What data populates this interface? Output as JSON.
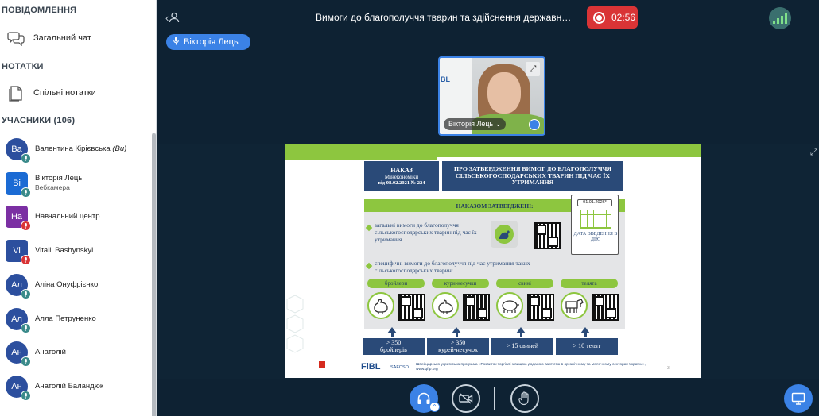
{
  "sidebar": {
    "messages_title": "ПОВІДОМЛЕННЯ",
    "public_chat": "Загальний чат",
    "notes_title": "НОТАТКИ",
    "shared_notes": "Спільні нотатки",
    "users_title": "УЧАСНИКИ (106)",
    "users": [
      {
        "initials": "Ва",
        "name": "Валентина Кірієвська",
        "suffix": "(Ви)",
        "sub": "",
        "color": "#2c4f9e",
        "square": false,
        "mic": "on"
      },
      {
        "initials": "Ві",
        "name": "Вікторія Лець",
        "suffix": "",
        "sub": "Вебкамера",
        "color": "#1b6bd4",
        "square": true,
        "mic": "on"
      },
      {
        "initials": "На",
        "name": "Навчальний центр",
        "suffix": "",
        "sub": "",
        "color": "#7b2fa3",
        "square": true,
        "mic": "muted"
      },
      {
        "initials": "Vi",
        "name": "Vitalii Bashynskyi",
        "suffix": "",
        "sub": "",
        "color": "#2c4f9e",
        "square": true,
        "mic": "muted"
      },
      {
        "initials": "Ал",
        "name": "Аліна Онуфрієнко",
        "suffix": "",
        "sub": "",
        "color": "#2c4f9e",
        "square": false,
        "mic": "on"
      },
      {
        "initials": "Ал",
        "name": "Алла Петруненко",
        "suffix": "",
        "sub": "",
        "color": "#2c4f9e",
        "square": false,
        "mic": "on"
      },
      {
        "initials": "Ан",
        "name": "Анатолій",
        "suffix": "",
        "sub": "",
        "color": "#2c4f9e",
        "square": false,
        "mic": "on"
      },
      {
        "initials": "Ан",
        "name": "Анатолій Баландюк",
        "suffix": "",
        "sub": "",
        "color": "#2c4f9e",
        "square": false,
        "mic": "on"
      }
    ]
  },
  "topbar": {
    "title": "Вимоги до благополуччя тварин та здійснення державно…",
    "record_time": "02:56"
  },
  "speaker": {
    "name": "Вікторія Лець"
  },
  "webcam": {
    "name": "Вікторія Лець ⌄",
    "board_text": "BL"
  },
  "slide": {
    "order_title": "НАКАЗ",
    "order_ministry": "Мінекономіки",
    "order_date": "від 08.02.2021 № 224",
    "approval_title": "ПРО ЗАТВЕРДЖЕННЯ ВИМОГ ДО БЛАГОПОЛУЧЧЯ СІЛЬСЬКОГОСПОДАРСЬКИХ ТВАРИН ПІД ЧАС ЇХ УТРИМАННЯ",
    "panel_header": "НАКАЗОМ ЗАТВЕРДЖЕНІ:",
    "bullet1": "загальні вимоги до благополуччя сільськогосподарських тварин під час їх утримання",
    "bullet2": "специфічні вимоги до благополуччя під час утримання таких сільськогосподарських тварин:",
    "categories": [
      "бройлери",
      "кури-несучки",
      "свині",
      "телята"
    ],
    "stats": [
      {
        "top": "> 350",
        "bottom": "бройлерів"
      },
      {
        "top": "> 350",
        "bottom": "курей-несучок"
      },
      {
        "top": "> 15 свиней",
        "bottom": ""
      },
      {
        "top": "> 10 телят",
        "bottom": ""
      }
    ],
    "calendar_date": "01.01.2026*",
    "calendar_caption": "ДАТА ВВЕДЕННЯ В ДІЮ",
    "footer_logo": "FiBL",
    "footer_logo2": "SAFOSO",
    "footer_program": "Швейцарсько-українська програма «Розвиток торгівлі з вищою доданою вартістю в органічному та молочному секторах України», www.qftp.org",
    "footer_page": "3"
  },
  "colors": {
    "accent": "#3b82e6",
    "record": "#d93436",
    "slide_green": "#8dc63f",
    "slide_navy": "#2a4a78",
    "background": "#0e2233"
  }
}
